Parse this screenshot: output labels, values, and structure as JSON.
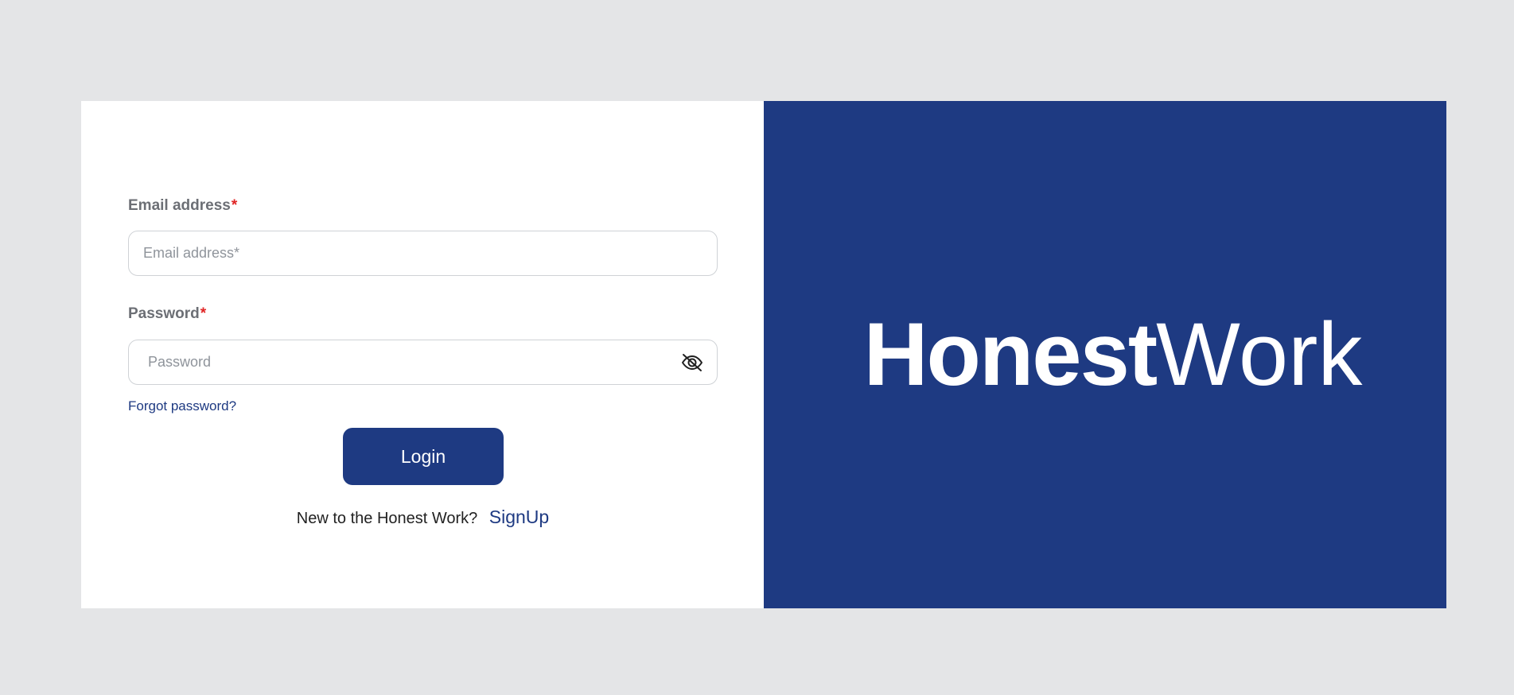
{
  "login_form": {
    "email_label": "Email address",
    "email_required_mark": "*",
    "email_placeholder": "Email address*",
    "email_value": "",
    "password_label": "Password",
    "password_required_mark": "*",
    "password_placeholder": "Password",
    "password_value": "",
    "password_toggle_icon": "eye-slash-icon",
    "forgot_password_label": "Forgot password?",
    "login_button_label": "Login",
    "signup_prompt": "New to the Honest Work?",
    "signup_link_label": "SignUp"
  },
  "brand": {
    "name_bold": "Honest",
    "name_light": "Work"
  },
  "colors": {
    "primary": "#1e3a82",
    "page_background": "#e4e5e7",
    "panel_background": "#ffffff",
    "required_mark": "#e02424",
    "label_text": "#6c6f75"
  }
}
